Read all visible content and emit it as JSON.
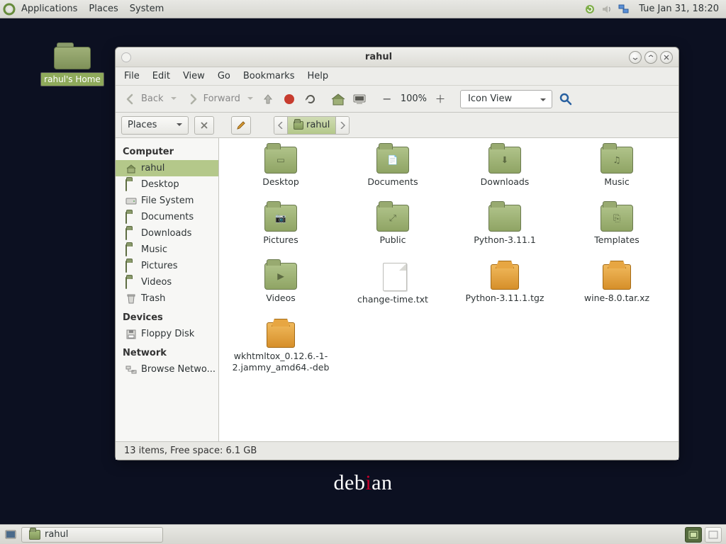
{
  "panel": {
    "menus": [
      "Applications",
      "Places",
      "System"
    ],
    "clock": "Tue Jan 31, 18:20"
  },
  "desktop": {
    "home_icon": "rahul's Home"
  },
  "taskbar": {
    "active": "rahul"
  },
  "debian_text": "debian",
  "window": {
    "title": "rahul",
    "menus": [
      "File",
      "Edit",
      "View",
      "Go",
      "Bookmarks",
      "Help"
    ],
    "toolbar": {
      "back": "Back",
      "forward": "Forward",
      "zoom": "100%",
      "view_mode": "Icon View"
    },
    "places_label": "Places",
    "breadcrumb": "rahul",
    "sidebar": {
      "computer": "Computer",
      "devices": "Devices",
      "network": "Network",
      "items_computer": [
        "rahul",
        "Desktop",
        "File System",
        "Documents",
        "Downloads",
        "Music",
        "Pictures",
        "Videos",
        "Trash"
      ],
      "items_devices": [
        "Floppy Disk"
      ],
      "items_network": [
        "Browse Netwo..."
      ]
    },
    "files": [
      {
        "name": "Desktop",
        "kind": "folder",
        "glyph": "▭"
      },
      {
        "name": "Documents",
        "kind": "folder",
        "glyph": "📄"
      },
      {
        "name": "Downloads",
        "kind": "folder",
        "glyph": "⬇"
      },
      {
        "name": "Music",
        "kind": "folder",
        "glyph": "♫"
      },
      {
        "name": "Pictures",
        "kind": "folder",
        "glyph": "📷"
      },
      {
        "name": "Public",
        "kind": "folder",
        "glyph": "⤢"
      },
      {
        "name": "Python-3.11.1",
        "kind": "folder",
        "glyph": ""
      },
      {
        "name": "Templates",
        "kind": "folder",
        "glyph": "⎘"
      },
      {
        "name": "Videos",
        "kind": "folder",
        "glyph": "▶"
      },
      {
        "name": "change-time.txt",
        "kind": "text"
      },
      {
        "name": "Python-3.11.1.tgz",
        "kind": "pkg"
      },
      {
        "name": "wine-8.0.tar.xz",
        "kind": "pkg"
      },
      {
        "name": "wkhtmltox_0.12.6.-1-2.jammy_amd64.-deb",
        "kind": "pkg",
        "tall": true
      }
    ],
    "status": "13 items, Free space: 6.1 GB"
  }
}
